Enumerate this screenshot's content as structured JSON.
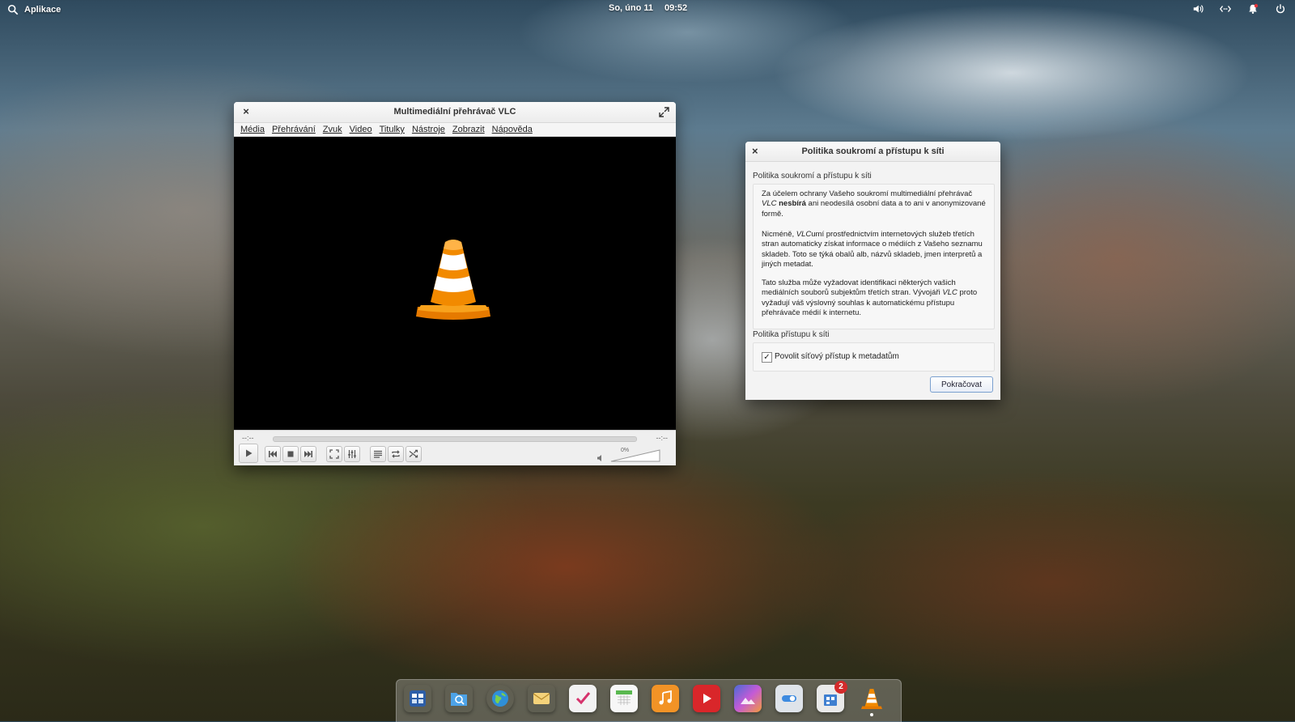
{
  "top_panel": {
    "apps_label": "Aplikace",
    "date": "So, úno 11",
    "time": "09:52",
    "icons": [
      "search-icon",
      "volume-icon",
      "network-icon",
      "notification-icon",
      "power-icon"
    ]
  },
  "vlc": {
    "title": "Multimediální přehrávač VLC",
    "menu": [
      "Média",
      "Přehrávání",
      "Zvuk",
      "Video",
      "Titulky",
      "Nástroje",
      "Zobrazit",
      "Nápověda"
    ],
    "time_elapsed": "--:--",
    "time_total": "--:--",
    "seek_progress": 0,
    "volume": "0%",
    "volume_level": 0,
    "controls": [
      "play-icon",
      "previous-icon",
      "stop-icon",
      "next-icon",
      "fullscreen-icon",
      "equalizer-icon",
      "playlist-icon",
      "loop-icon",
      "shuffle-icon"
    ],
    "colors": {
      "cone_orange": "#f28a00",
      "video_bg": "#000000"
    }
  },
  "dialog": {
    "title": "Politika soukromí a přístupu k síti",
    "section1_label": "Politika soukromí a přístupu k síti",
    "para1_a": "Za účelem ochrany Vašeho soukromí multimediální přehrávač ",
    "para1_vlc": "VLC",
    "para1_b": " ",
    "para1_bold": "nesbírá",
    "para1_c": " ani neodesílá osobní data a to ani v anonymizované formě.",
    "para2_a": "Nicméně, ",
    "para2_vlc": "VLC",
    "para2_b": "umí prostřednictvím internetových služeb třetích stran automaticky získat informace o médiích z Vašeho seznamu skladeb. Toto se týká obalů alb, názvů skladeb, jmen interpretů a jiných metadat.",
    "para3_a": "Tato služba může vyžadovat identifikaci některých vašich mediálních souborů subjektům třetích stran. Vývojáři ",
    "para3_vlc": "VLC",
    "para3_b": " proto vyžadují váš výslovný souhlas k automatickému přístupu přehrávače médií k internetu.",
    "section2_label": "Politika přístupu k síti",
    "checkbox_label": "Povolit síťový přístup k metadatům",
    "checkbox_checked": true,
    "checkbox_mark": "✓",
    "continue_button": "Pokračovat"
  },
  "dock": {
    "items": [
      {
        "name": "multitasking-view-icon",
        "color": "#3d6fb3"
      },
      {
        "name": "files-icon",
        "color": "#4da3e8"
      },
      {
        "name": "web-browser-icon",
        "color": "#2f8fd8"
      },
      {
        "name": "mail-icon",
        "color": "#f0c55a"
      },
      {
        "name": "tasks-icon",
        "color": "#e8e8e8"
      },
      {
        "name": "calendar-icon",
        "color": "#f4f4f4"
      },
      {
        "name": "music-icon",
        "color": "#f29326"
      },
      {
        "name": "videos-icon",
        "color": "#d9262a"
      },
      {
        "name": "photos-icon",
        "color": "#9b5bd6"
      },
      {
        "name": "settings-icon",
        "color": "#dfe4ea"
      },
      {
        "name": "appcenter-icon",
        "color": "#eaeaea",
        "badge": "2"
      },
      {
        "name": "vlc-icon",
        "color": "transparent"
      }
    ]
  }
}
